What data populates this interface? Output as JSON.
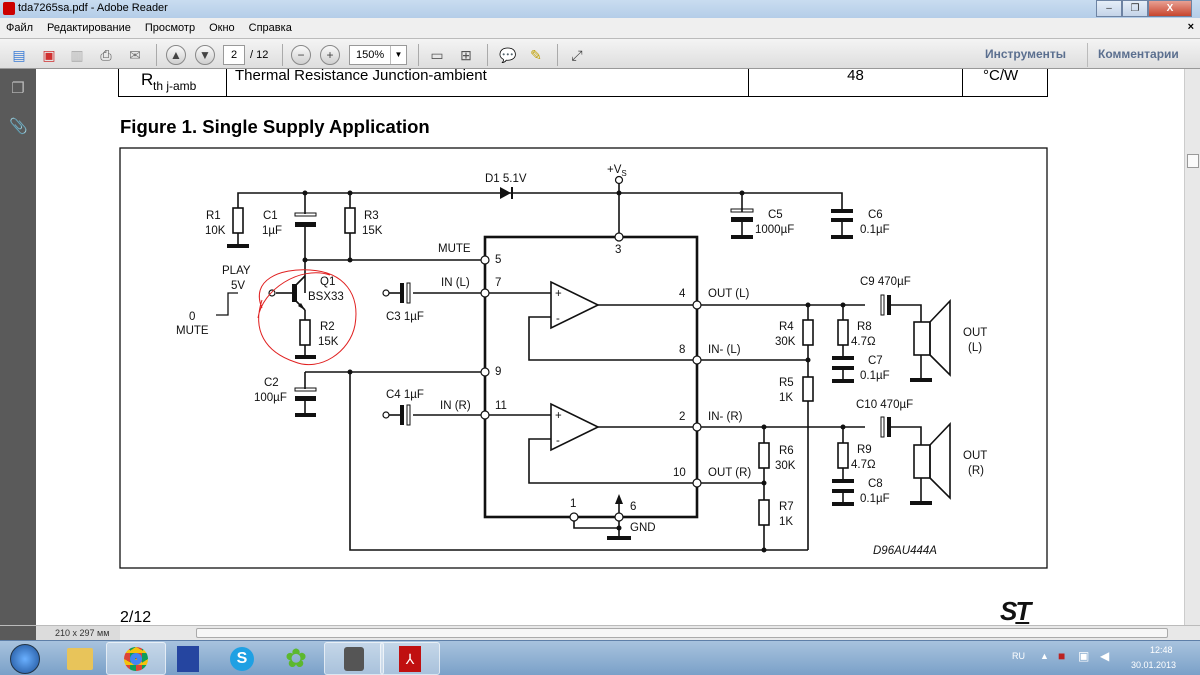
{
  "window": {
    "title": "tda7265sa.pdf - Adobe Reader",
    "minimize": "–",
    "restore": "❐",
    "close": "X"
  },
  "menu": [
    "Файл",
    "Редактирование",
    "Просмотр",
    "Окно",
    "Справка"
  ],
  "menu_close": "×",
  "toolbar": {
    "page_current": "2",
    "page_total": "/ 12",
    "zoom": "150%",
    "tools": "Инструменты",
    "comments": "Комментарии"
  },
  "document": {
    "table_row": {
      "symbol": "R",
      "symbol_sub": "th j-amb",
      "parameter": "Thermal Resistance Junction-ambient",
      "value": "48",
      "unit": "°C/W"
    },
    "figure_title": "Figure 1. Single Supply Application",
    "page_footer": "2/12",
    "logo": "ST"
  },
  "schematic": {
    "R1": "R1",
    "R1v": "10K",
    "C1": "C1",
    "C1v": "1µF",
    "R3": "R3",
    "R3v": "15K",
    "D1": "D1 5.1V",
    "VS": "+V",
    "VSsub": "S",
    "MUTE": "MUTE",
    "PLAY": "PLAY",
    "V5": "5V",
    "Z0": "0",
    "MUTE2": "MUTE",
    "Q1": "Q1",
    "Q1v": "BSX33",
    "R2": "R2",
    "R2v": "15K",
    "C2": "C2",
    "C2v": "100µF",
    "C3": "C3 1µF",
    "C4": "C4 1µF",
    "INL": "IN (L)",
    "INR": "IN (R)",
    "p5": "5",
    "p7": "7",
    "p9": "9",
    "p11": "11",
    "p3": "3",
    "p4": "4",
    "p8": "8",
    "p2": "2",
    "p10": "10",
    "p1": "1",
    "p6": "6",
    "OUTL": "OUT (L)",
    "INML": "IN- (L)",
    "INMR": "IN- (R)",
    "OUTR": "OUT (R)",
    "GND": "GND",
    "C5": "C5",
    "C5v": "1000µF",
    "C6": "C6",
    "C6v": "0.1µF",
    "C9": "C9 470µF",
    "C10": "C10 470µF",
    "R4": "R4",
    "R4v": "30K",
    "R5": "R5",
    "R5v": "1K",
    "R6": "R6",
    "R6v": "30K",
    "R7": "R7",
    "R7v": "1K",
    "R8": "R8",
    "R8v": "4.7Ω",
    "R9": "R9",
    "R9v": "4.7Ω",
    "C7": "C7",
    "C7v": "0.1µF",
    "C8": "C8",
    "C8v": "0.1µF",
    "SPKL1": "OUT",
    "SPKL2": "(L)",
    "SPKR1": "OUT",
    "SPKR2": "(R)",
    "code": "D96AU444A",
    "annotation_color": "#e02020"
  },
  "statusbar": {
    "page_size": "210 x 297 мм"
  },
  "taskbar": {
    "lang": "RU",
    "time": "12:48",
    "date": "30.01.2013",
    "apps": [
      "windows-explorer",
      "chrome",
      "save-app",
      "skype",
      "icq",
      "app-tool",
      "adobe-reader"
    ]
  }
}
